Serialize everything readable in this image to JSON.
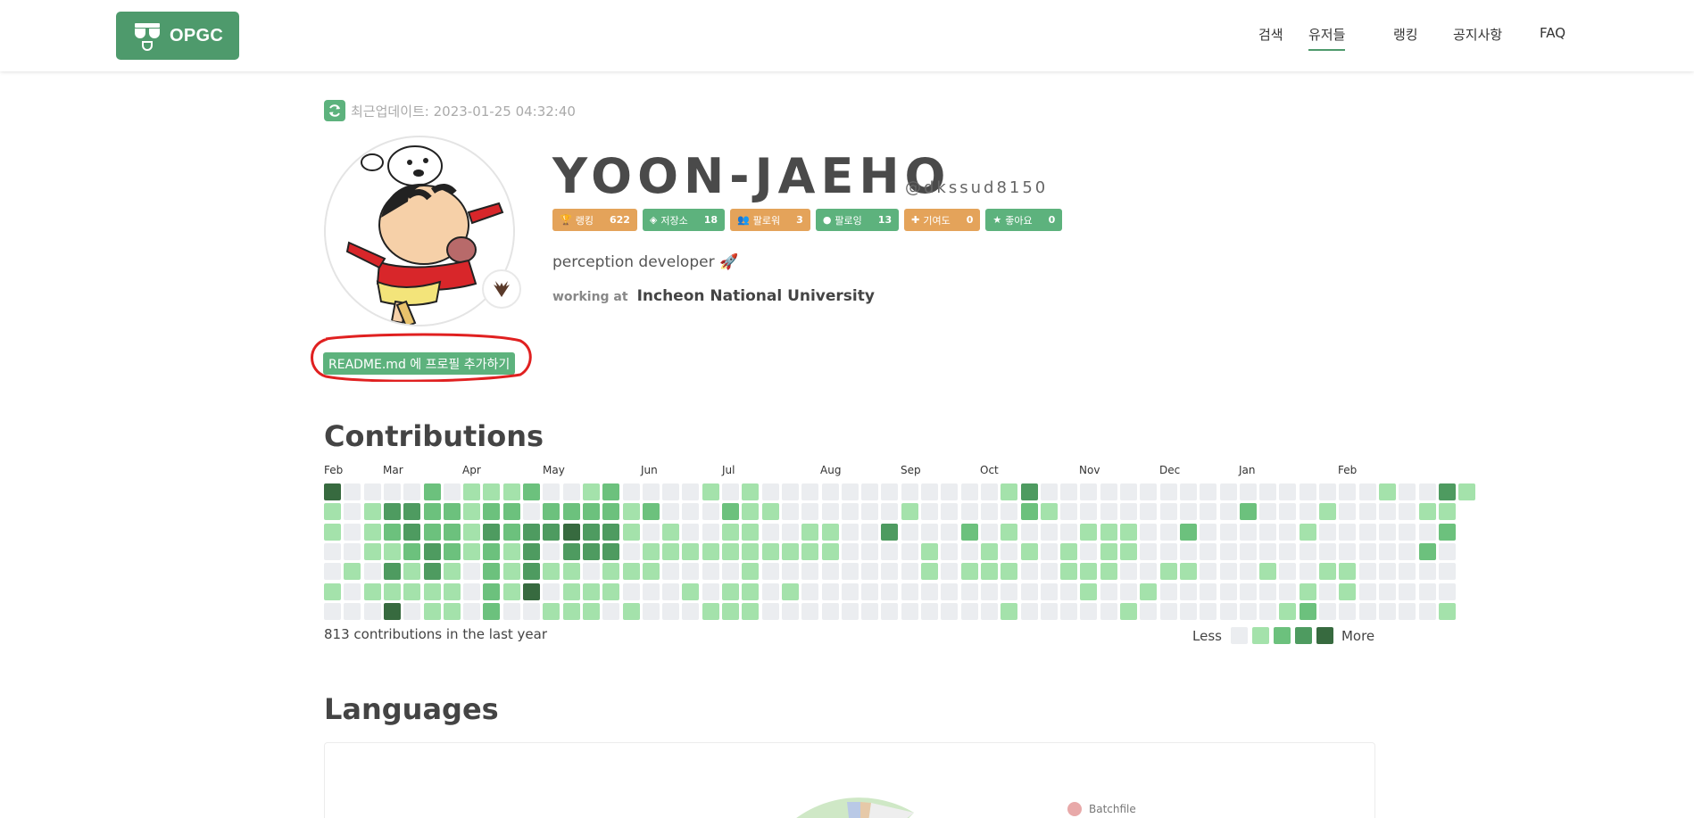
{
  "nav": {
    "logo_text": "OPGC",
    "items": [
      {
        "label": "검색",
        "active": false
      },
      {
        "label": "유저들",
        "active": true
      },
      {
        "label": "랭킹",
        "active": false
      },
      {
        "label": "공지사항",
        "active": false
      },
      {
        "label": "FAQ",
        "active": false
      }
    ]
  },
  "profile": {
    "update_label": "최근업데이트: 2023-01-25 04:32:40",
    "name": "YOON-JAEHO",
    "handle": "@dkssud8150",
    "readme_button": "README.md 에 프로필 추가하기",
    "bio": "perception developer 🚀",
    "company_label": "working at",
    "company": "Incheon National University",
    "badges": [
      {
        "label": "랭킹",
        "value": "622",
        "icon": "trophy-icon",
        "color": "#e4a35a"
      },
      {
        "label": "저장소",
        "value": "18",
        "icon": "repo-icon",
        "color": "#5db27d"
      },
      {
        "label": "팔로워",
        "value": "3",
        "icon": "users-icon",
        "color": "#e4a35a"
      },
      {
        "label": "팔로잉",
        "value": "13",
        "icon": "following-icon",
        "color": "#5db27d"
      },
      {
        "label": "기여도",
        "value": "0",
        "icon": "puzzle-icon",
        "color": "#e4a35a"
      },
      {
        "label": "좋아요",
        "value": "0",
        "icon": "star-icon",
        "color": "#5db27d"
      }
    ]
  },
  "contributions": {
    "title": "Contributions",
    "months": [
      "Feb",
      "Mar",
      "Apr",
      "May",
      "Jun",
      "Jul",
      "Aug",
      "Sep",
      "Oct",
      "Nov",
      "Dec",
      "Jan",
      "Feb"
    ],
    "total": "813 contributions in the last year",
    "legend_less": "Less",
    "legend_more": "More",
    "colors": [
      "#ebedf0",
      "#a4e2ab",
      "#6cc17d",
      "#4e9b60",
      "#376a3f"
    ],
    "weeks": [
      [
        4,
        1,
        1,
        0,
        0,
        1,
        0
      ],
      [
        0,
        0,
        0,
        0,
        1,
        0,
        0
      ],
      [
        0,
        1,
        1,
        1,
        0,
        1,
        0
      ],
      [
        0,
        3,
        2,
        1,
        3,
        1,
        4
      ],
      [
        0,
        3,
        3,
        2,
        1,
        1,
        0
      ],
      [
        2,
        2,
        2,
        3,
        3,
        1,
        1
      ],
      [
        0,
        2,
        2,
        2,
        1,
        1,
        1
      ],
      [
        1,
        1,
        1,
        1,
        0,
        0,
        0
      ],
      [
        1,
        2,
        3,
        2,
        2,
        2,
        2
      ],
      [
        1,
        2,
        2,
        1,
        1,
        1,
        0
      ],
      [
        2,
        0,
        3,
        3,
        3,
        4,
        0
      ],
      [
        0,
        2,
        3,
        0,
        1,
        0,
        1
      ],
      [
        0,
        2,
        4,
        3,
        1,
        1,
        1
      ],
      [
        1,
        2,
        3,
        3,
        0,
        1,
        1
      ],
      [
        2,
        2,
        3,
        3,
        1,
        1,
        0
      ],
      [
        0,
        1,
        1,
        0,
        1,
        0,
        1
      ],
      [
        0,
        2,
        0,
        1,
        1,
        0,
        0
      ],
      [
        0,
        0,
        1,
        1,
        0,
        0,
        0
      ],
      [
        0,
        0,
        0,
        1,
        0,
        1,
        0
      ],
      [
        1,
        0,
        0,
        1,
        0,
        0,
        1
      ],
      [
        0,
        2,
        1,
        1,
        0,
        1,
        1
      ],
      [
        1,
        1,
        1,
        1,
        1,
        1,
        1
      ],
      [
        0,
        1,
        0,
        1,
        0,
        0,
        0
      ],
      [
        0,
        0,
        0,
        1,
        0,
        1,
        0
      ],
      [
        0,
        0,
        1,
        1,
        0,
        0,
        0
      ],
      [
        0,
        0,
        1,
        1,
        0,
        0,
        0
      ],
      [
        0,
        0,
        0,
        0,
        0,
        0,
        0
      ],
      [
        0,
        0,
        0,
        0,
        0,
        0,
        0
      ],
      [
        0,
        0,
        3,
        0,
        0,
        0,
        0
      ],
      [
        0,
        1,
        0,
        0,
        0,
        0,
        0
      ],
      [
        0,
        0,
        0,
        1,
        1,
        0,
        0
      ],
      [
        0,
        0,
        0,
        0,
        0,
        0,
        0
      ],
      [
        0,
        0,
        2,
        0,
        1,
        0,
        0
      ],
      [
        0,
        0,
        0,
        1,
        1,
        0,
        0
      ],
      [
        1,
        0,
        1,
        0,
        1,
        0,
        1
      ],
      [
        3,
        2,
        0,
        1,
        0,
        0,
        0
      ],
      [
        0,
        1,
        0,
        0,
        0,
        0,
        0
      ],
      [
        0,
        0,
        0,
        1,
        1,
        0,
        0
      ],
      [
        0,
        0,
        1,
        0,
        1,
        1,
        0
      ],
      [
        0,
        0,
        1,
        1,
        1,
        0,
        0
      ],
      [
        0,
        0,
        1,
        1,
        0,
        0,
        1
      ],
      [
        0,
        0,
        0,
        0,
        0,
        1,
        0
      ],
      [
        0,
        0,
        0,
        0,
        1,
        0,
        0
      ],
      [
        0,
        0,
        2,
        0,
        1,
        0,
        0
      ],
      [
        0,
        0,
        0,
        0,
        0,
        0,
        0
      ],
      [
        0,
        0,
        0,
        0,
        0,
        0,
        0
      ],
      [
        0,
        2,
        0,
        0,
        0,
        0,
        0
      ],
      [
        0,
        0,
        0,
        0,
        1,
        0,
        0
      ],
      [
        0,
        0,
        0,
        0,
        0,
        0,
        1
      ],
      [
        0,
        0,
        1,
        0,
        0,
        1,
        2
      ],
      [
        0,
        1,
        0,
        0,
        1,
        0,
        0
      ],
      [
        0,
        0,
        0,
        0,
        1,
        1,
        0
      ],
      [
        0,
        0,
        0,
        0,
        0,
        0,
        0
      ],
      [
        1,
        0,
        0,
        0,
        0,
        0,
        0
      ],
      [
        0,
        0,
        0,
        0,
        0,
        0,
        0
      ],
      [
        0,
        1,
        0,
        2,
        0,
        0,
        0
      ],
      [
        3,
        1,
        2,
        0,
        0,
        0,
        1
      ],
      [
        1
      ]
    ]
  },
  "languages": {
    "title": "Languages",
    "legend": [
      {
        "name": "Batchfile",
        "color": "#e8a9a9"
      }
    ]
  }
}
